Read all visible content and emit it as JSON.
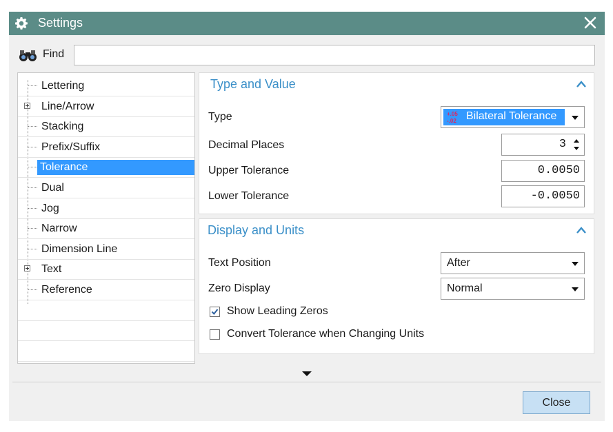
{
  "window": {
    "title": "Settings"
  },
  "find": {
    "label": "Find",
    "value": ""
  },
  "tree": {
    "items": [
      {
        "label": "Lettering",
        "expandable": false
      },
      {
        "label": "Line/Arrow",
        "expandable": true
      },
      {
        "label": "Stacking",
        "expandable": false
      },
      {
        "label": "Prefix/Suffix",
        "expandable": false
      },
      {
        "label": "Tolerance",
        "expandable": false,
        "selected": true
      },
      {
        "label": "Dual",
        "expandable": false
      },
      {
        "label": "Jog",
        "expandable": false
      },
      {
        "label": "Narrow",
        "expandable": false
      },
      {
        "label": "Dimension Line",
        "expandable": false
      },
      {
        "label": "Text",
        "expandable": true
      },
      {
        "label": "Reference",
        "expandable": false
      }
    ]
  },
  "type_value": {
    "heading": "Type and Value",
    "type_label": "Type",
    "type_value": "Bilateral Tolerance",
    "type_icon_upper": "+.05",
    "type_icon_lower": "-.02",
    "decimal_label": "Decimal Places",
    "decimal_value": "3",
    "upper_label": "Upper Tolerance",
    "upper_value": "0.0050",
    "lower_label": "Lower Tolerance",
    "lower_value": "-0.0050"
  },
  "display_units": {
    "heading": "Display and Units",
    "text_position_label": "Text Position",
    "text_position_value": "After",
    "zero_display_label": "Zero Display",
    "zero_display_value": "Normal",
    "show_leading_zeros_label": "Show Leading Zeros",
    "show_leading_zeros_checked": true,
    "convert_tolerance_label": "Convert Tolerance when Changing Units",
    "convert_tolerance_checked": false
  },
  "footer": {
    "close_label": "Close"
  },
  "colors": {
    "titlebar": "#5b8c87",
    "selection": "#3399ff",
    "heading": "#3a8fc8",
    "button": "#c7e0f4"
  }
}
